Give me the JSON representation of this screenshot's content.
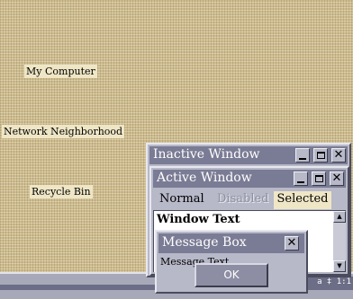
{
  "desktop": {
    "icons": [
      {
        "label": "My Computer",
        "icon": "computer-icon"
      },
      {
        "label": "Network Neighborhood",
        "icon": "network-icon"
      },
      {
        "label": "Recycle Bin",
        "icon": "recycle-bin-icon"
      }
    ]
  },
  "taskbar": {
    "tray_text": "a ‡ 1:1"
  },
  "inactive_window": {
    "title": "Inactive Window"
  },
  "active_window": {
    "title": "Active Window",
    "menu": {
      "normal": "Normal",
      "disabled": "Disabled",
      "selected": "Selected"
    },
    "window_text": "Window Text"
  },
  "message_box": {
    "title": "Message Box",
    "text": "Message Text",
    "ok_label": "OK"
  },
  "colors": {
    "desktop": "#cdbb8e",
    "window_face": "#b7b8c8",
    "title_bar": "#7a7b94",
    "selected_highlight": "#efe6c6",
    "disabled_text": "#8e8fa0"
  }
}
